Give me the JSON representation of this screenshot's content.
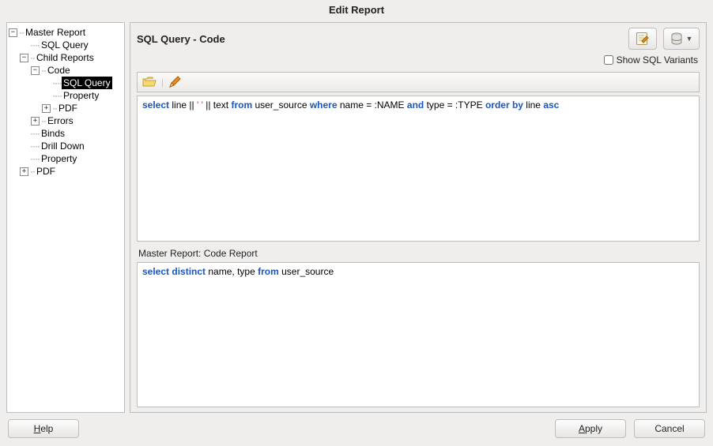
{
  "window": {
    "title": "Edit Report"
  },
  "tree": {
    "root": "Master Report",
    "sql_query": "SQL Query",
    "child_reports": "Child Reports",
    "code": "Code",
    "code_sql_query": "SQL Query",
    "code_property": "Property",
    "code_pdf": "PDF",
    "errors": "Errors",
    "binds": "Binds",
    "drill_down": "Drill Down",
    "property": "Property",
    "pdf": "PDF"
  },
  "main": {
    "title": "SQL Query - Code",
    "show_variants_label": "Show SQL Variants",
    "sub_label": "Master Report:   Code Report"
  },
  "sql": {
    "top": {
      "s1": "select",
      "s2": " line || ",
      "s3": "' '",
      "s4": " || text ",
      "s5": "from",
      "s6": " user_source ",
      "s7": "where",
      "s8": " name = :NAME ",
      "s9": "and",
      "s10": " type = :TYPE ",
      "s11": "order by",
      "s12": " line ",
      "s13": "asc"
    },
    "bottom": {
      "s1": "select",
      "s2": " ",
      "s3": "distinct",
      "s4": " name, type ",
      "s5": "from",
      "s6": " user_source"
    }
  },
  "footer": {
    "help": "Help",
    "help_u": "H",
    "help_rest": "elp",
    "apply": "Apply",
    "apply_u": "A",
    "apply_rest": "pply",
    "cancel": "Cancel"
  },
  "icons": {
    "edit": "edit-icon",
    "db": "database-icon",
    "folder": "folder-icon",
    "pencil": "pencil-icon"
  }
}
